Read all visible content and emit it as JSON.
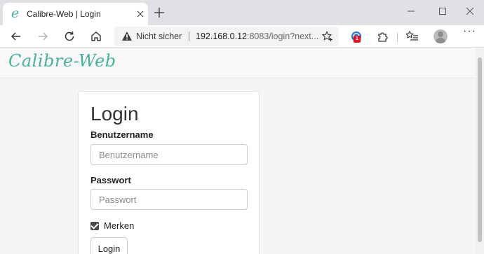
{
  "browser": {
    "tab": {
      "title": "Calibre-Web | Login",
      "favicon": "e"
    },
    "newtab_symbol": "+",
    "window_controls": [
      "minimize",
      "maximize",
      "close"
    ],
    "toolbar_icons": [
      "back-icon",
      "forward-icon",
      "reload-icon",
      "home-icon",
      "favorites-add-icon",
      "extension-icon",
      "extensions-icon",
      "collections-icon",
      "profile-icon",
      "more-icon"
    ],
    "address": {
      "security_label": "Nicht sicher",
      "host": "192.168.0.12",
      "rest": ":8083/login?next..."
    },
    "extension_badge": "1",
    "more_label": "···"
  },
  "app": {
    "brand": "Calibre-Web",
    "accent_color": "#45b29d"
  },
  "login": {
    "title": "Login",
    "username": {
      "label": "Benutzername",
      "placeholder": "Benutzername",
      "value": ""
    },
    "password": {
      "label": "Passwort",
      "placeholder": "Passwort",
      "value": ""
    },
    "remember": {
      "label": "Merken",
      "checked": true
    },
    "submit_label": "Login"
  }
}
